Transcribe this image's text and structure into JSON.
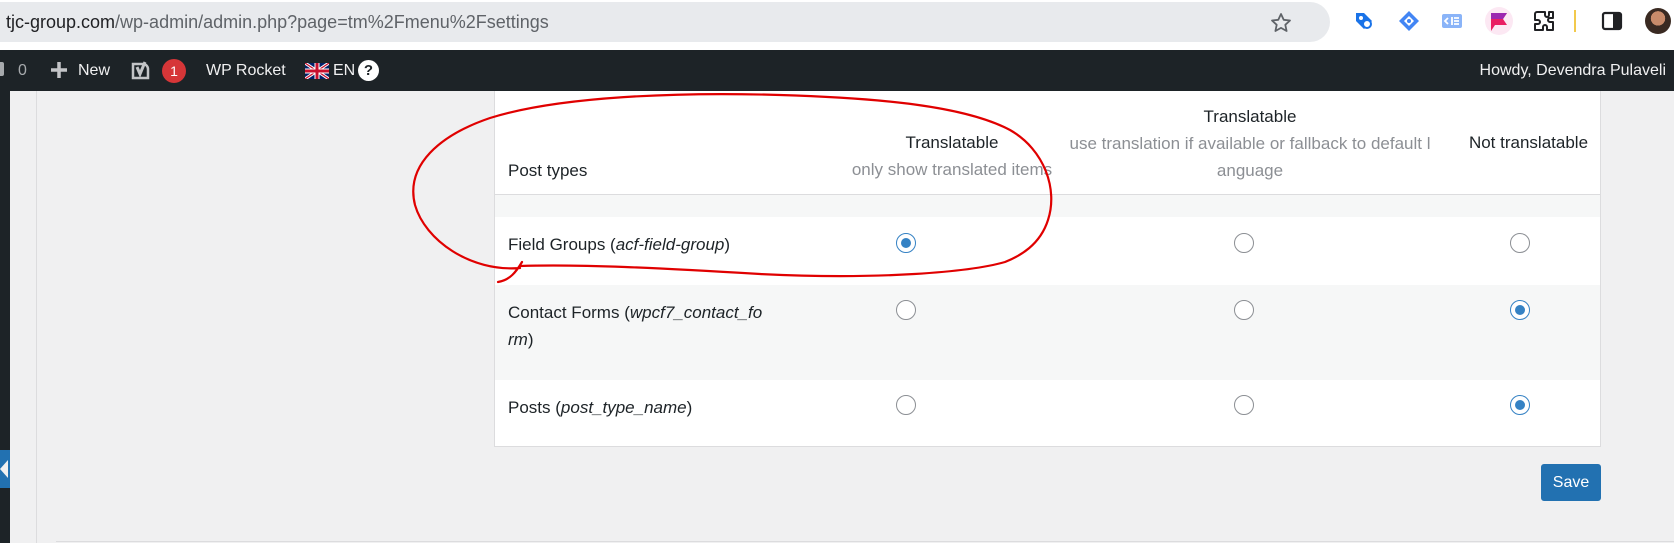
{
  "browser": {
    "url_domain": "tjc-group.com",
    "url_path": "/wp-admin/admin.php?page=tm%2Fmenu%2Fsettings"
  },
  "admin_bar": {
    "comment_count": "0",
    "new_label": "New",
    "yoast_badge": "1",
    "wp_rocket_label": "WP Rocket",
    "language_label": "EN",
    "help_label": "?",
    "greeting": "Howdy, Devendra Pulaveli"
  },
  "table": {
    "header": {
      "post_types": "Post types",
      "col1_title": "Translatable",
      "col1_desc": "only show translated items",
      "col2_title": "Translatable",
      "col2_desc_line1": "use translation if available or fallback to default l",
      "col2_desc_line2": "anguage",
      "col3_title": "Not translatable"
    },
    "rows": [
      {
        "name": "Field Groups",
        "slug_line1": "acf-field-group",
        "slug_line2": "",
        "selected": 0
      },
      {
        "name": "Contact Forms",
        "slug_line1": "wpcf7_contact_fo",
        "slug_line2": "rm",
        "selected": 2
      },
      {
        "name": "Posts",
        "slug_line1": "post_type_name",
        "slug_line2": "",
        "selected": 2
      }
    ]
  },
  "save_label": "Save",
  "colors": {
    "accent": "#2271b1",
    "radio_checked": "#3582c4",
    "annotation": "#e00000",
    "admin_bar": "#1d2327"
  }
}
